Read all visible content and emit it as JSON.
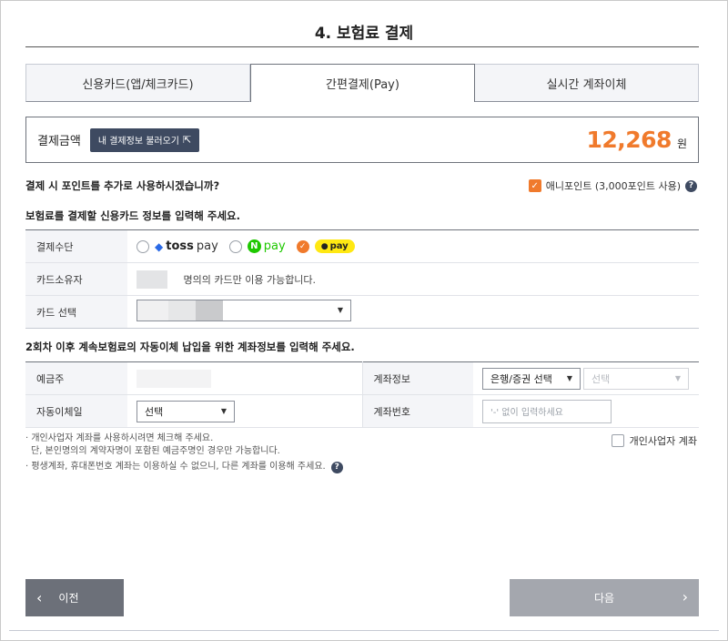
{
  "step_title": "4. 보험료 결제",
  "tabs": [
    {
      "label": "신용카드(앱/체크카드)",
      "active": false
    },
    {
      "label": "간편결제(Pay)",
      "active": true
    },
    {
      "label": "실시간 계좌이체",
      "active": false
    }
  ],
  "amount": {
    "label": "결제금액",
    "load_button": "내 결제정보 불러오기",
    "load_icon": "export-icon",
    "value": "12,268",
    "unit": "원"
  },
  "point_question": "결제 시 포인트를 추가로 사용하시겠습니까?",
  "point_option": {
    "label": "애니포인트 (3,000포인트 사용)",
    "checked": true
  },
  "card_section_title": "보험료를 결제할 신용카드 정보를 입력해 주세요.",
  "card_form": {
    "method_label": "결제수단",
    "methods": [
      {
        "name": "toss",
        "text": "toss",
        "suffix": "pay",
        "selected": false
      },
      {
        "name": "npay",
        "badge": "N",
        "text": "pay",
        "selected": false
      },
      {
        "name": "kakaopay",
        "text": "pay",
        "selected": true
      }
    ],
    "owner_label": "카드소유자",
    "owner_note": "명의의 카드만 이용 가능합니다.",
    "card_select_label": "카드 선택"
  },
  "auto_section_title": "2회차 이후 계속보험료의 자동이체 납입을 위한 계좌정보를 입력해 주세요.",
  "auto_form": {
    "depositor_label": "예금주",
    "account_info_label": "계좌정보",
    "bank_select": "은행/증권 선택",
    "sub_select": "선택",
    "transfer_day_label": "자동이체일",
    "transfer_day_select": "선택",
    "account_number_label": "계좌번호",
    "account_number_placeholder": "'-' 없이 입력하세요"
  },
  "notes": [
    "· 개인사업자 계좌를 사용하시려면 체크해 주세요.",
    "단, 본인명의의 계약자명이 포함된 예금주명인 경우만 가능합니다.",
    "· 평생계좌, 휴대폰번호 계좌는 이용하실 수 없으니, 다른 계좌를 이용해 주세요."
  ],
  "business_account": {
    "label": "개인사업자 계좌",
    "checked": false
  },
  "buttons": {
    "prev": "이전",
    "next": "다음"
  },
  "colors": {
    "accent": "#f07a2c",
    "navy": "#3e4a61",
    "kakao": "#ffe812",
    "naver": "#1ec800",
    "toss": "#2b6ae6"
  }
}
